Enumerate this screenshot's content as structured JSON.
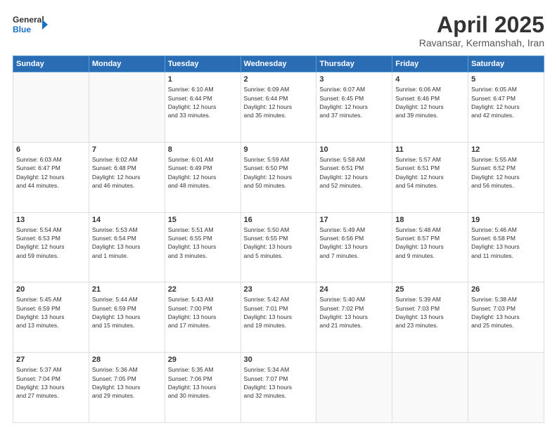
{
  "header": {
    "logo_line1": "General",
    "logo_line2": "Blue",
    "title": "April 2025",
    "location": "Ravansar, Kermanshah, Iran"
  },
  "weekdays": [
    "Sunday",
    "Monday",
    "Tuesday",
    "Wednesday",
    "Thursday",
    "Friday",
    "Saturday"
  ],
  "weeks": [
    [
      {
        "day": "",
        "detail": ""
      },
      {
        "day": "",
        "detail": ""
      },
      {
        "day": "1",
        "detail": "Sunrise: 6:10 AM\nSunset: 6:44 PM\nDaylight: 12 hours\nand 33 minutes."
      },
      {
        "day": "2",
        "detail": "Sunrise: 6:09 AM\nSunset: 6:44 PM\nDaylight: 12 hours\nand 35 minutes."
      },
      {
        "day": "3",
        "detail": "Sunrise: 6:07 AM\nSunset: 6:45 PM\nDaylight: 12 hours\nand 37 minutes."
      },
      {
        "day": "4",
        "detail": "Sunrise: 6:06 AM\nSunset: 6:46 PM\nDaylight: 12 hours\nand 39 minutes."
      },
      {
        "day": "5",
        "detail": "Sunrise: 6:05 AM\nSunset: 6:47 PM\nDaylight: 12 hours\nand 42 minutes."
      }
    ],
    [
      {
        "day": "6",
        "detail": "Sunrise: 6:03 AM\nSunset: 6:47 PM\nDaylight: 12 hours\nand 44 minutes."
      },
      {
        "day": "7",
        "detail": "Sunrise: 6:02 AM\nSunset: 6:48 PM\nDaylight: 12 hours\nand 46 minutes."
      },
      {
        "day": "8",
        "detail": "Sunrise: 6:01 AM\nSunset: 6:49 PM\nDaylight: 12 hours\nand 48 minutes."
      },
      {
        "day": "9",
        "detail": "Sunrise: 5:59 AM\nSunset: 6:50 PM\nDaylight: 12 hours\nand 50 minutes."
      },
      {
        "day": "10",
        "detail": "Sunrise: 5:58 AM\nSunset: 6:51 PM\nDaylight: 12 hours\nand 52 minutes."
      },
      {
        "day": "11",
        "detail": "Sunrise: 5:57 AM\nSunset: 6:51 PM\nDaylight: 12 hours\nand 54 minutes."
      },
      {
        "day": "12",
        "detail": "Sunrise: 5:55 AM\nSunset: 6:52 PM\nDaylight: 12 hours\nand 56 minutes."
      }
    ],
    [
      {
        "day": "13",
        "detail": "Sunrise: 5:54 AM\nSunset: 6:53 PM\nDaylight: 12 hours\nand 59 minutes."
      },
      {
        "day": "14",
        "detail": "Sunrise: 5:53 AM\nSunset: 6:54 PM\nDaylight: 13 hours\nand 1 minute."
      },
      {
        "day": "15",
        "detail": "Sunrise: 5:51 AM\nSunset: 6:55 PM\nDaylight: 13 hours\nand 3 minutes."
      },
      {
        "day": "16",
        "detail": "Sunrise: 5:50 AM\nSunset: 6:55 PM\nDaylight: 13 hours\nand 5 minutes."
      },
      {
        "day": "17",
        "detail": "Sunrise: 5:49 AM\nSunset: 6:56 PM\nDaylight: 13 hours\nand 7 minutes."
      },
      {
        "day": "18",
        "detail": "Sunrise: 5:48 AM\nSunset: 6:57 PM\nDaylight: 13 hours\nand 9 minutes."
      },
      {
        "day": "19",
        "detail": "Sunrise: 5:46 AM\nSunset: 6:58 PM\nDaylight: 13 hours\nand 11 minutes."
      }
    ],
    [
      {
        "day": "20",
        "detail": "Sunrise: 5:45 AM\nSunset: 6:59 PM\nDaylight: 13 hours\nand 13 minutes."
      },
      {
        "day": "21",
        "detail": "Sunrise: 5:44 AM\nSunset: 6:59 PM\nDaylight: 13 hours\nand 15 minutes."
      },
      {
        "day": "22",
        "detail": "Sunrise: 5:43 AM\nSunset: 7:00 PM\nDaylight: 13 hours\nand 17 minutes."
      },
      {
        "day": "23",
        "detail": "Sunrise: 5:42 AM\nSunset: 7:01 PM\nDaylight: 13 hours\nand 19 minutes."
      },
      {
        "day": "24",
        "detail": "Sunrise: 5:40 AM\nSunset: 7:02 PM\nDaylight: 13 hours\nand 21 minutes."
      },
      {
        "day": "25",
        "detail": "Sunrise: 5:39 AM\nSunset: 7:03 PM\nDaylight: 13 hours\nand 23 minutes."
      },
      {
        "day": "26",
        "detail": "Sunrise: 5:38 AM\nSunset: 7:03 PM\nDaylight: 13 hours\nand 25 minutes."
      }
    ],
    [
      {
        "day": "27",
        "detail": "Sunrise: 5:37 AM\nSunset: 7:04 PM\nDaylight: 13 hours\nand 27 minutes."
      },
      {
        "day": "28",
        "detail": "Sunrise: 5:36 AM\nSunset: 7:05 PM\nDaylight: 13 hours\nand 29 minutes."
      },
      {
        "day": "29",
        "detail": "Sunrise: 5:35 AM\nSunset: 7:06 PM\nDaylight: 13 hours\nand 30 minutes."
      },
      {
        "day": "30",
        "detail": "Sunrise: 5:34 AM\nSunset: 7:07 PM\nDaylight: 13 hours\nand 32 minutes."
      },
      {
        "day": "",
        "detail": ""
      },
      {
        "day": "",
        "detail": ""
      },
      {
        "day": "",
        "detail": ""
      }
    ]
  ]
}
